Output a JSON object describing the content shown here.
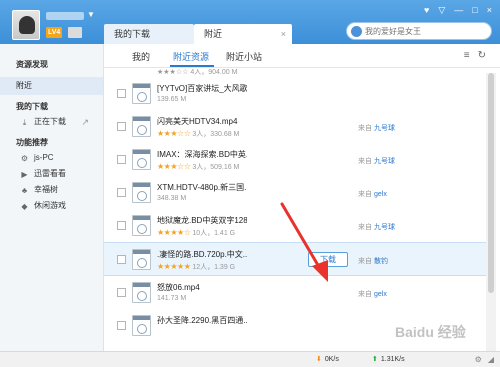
{
  "header": {
    "level_badge": "LV4",
    "tabs": [
      {
        "label": "我的下载"
      },
      {
        "label": "附近"
      }
    ],
    "tab_close": "×",
    "search_placeholder": "我的爱好是女王",
    "window_controls": [
      "♥",
      "▽",
      "—",
      "□",
      "×"
    ]
  },
  "sidebar": {
    "items": [
      {
        "label": "资源发现",
        "type": "heading"
      },
      {
        "label": "附近",
        "type": "selected"
      },
      {
        "label": "我的下载",
        "type": "heading"
      },
      {
        "label": "正在下载",
        "type": "sub",
        "icon": "download-icon"
      },
      {
        "label": "功能推荐",
        "type": "heading"
      },
      {
        "label": "js-PC",
        "type": "sub",
        "icon": "gear-icon"
      },
      {
        "label": "迅雷看看",
        "type": "sub",
        "icon": "play-icon"
      },
      {
        "label": "幸福树",
        "type": "sub",
        "icon": "tree-icon"
      },
      {
        "label": "休闲游戏",
        "type": "sub",
        "icon": "gamepad-icon"
      }
    ]
  },
  "subtabs": [
    {
      "label": "我的"
    },
    {
      "label": "附近资源"
    },
    {
      "label": "附近小站"
    }
  ],
  "list": {
    "top_partial_meta": "4人，904.00 M",
    "rows": [
      {
        "title": "[YYTvO]百家讲坛_大风歌...",
        "stars": "",
        "meta": "139.65 M",
        "source_label": "",
        "source_user": ""
      },
      {
        "title": "闪亮美天HDTV34.mp4",
        "stars": "★★★☆☆",
        "meta": "3人，330.68 M",
        "source_label": "来自",
        "source_user": "九号球"
      },
      {
        "title": "IMAX：深海探索.BD中英...",
        "stars": "★★★☆☆",
        "meta": "3人，509.16 M",
        "source_label": "来自",
        "source_user": "九号球"
      },
      {
        "title": "XTM.HDTV-480p.新三国...",
        "stars": "",
        "meta": "348.38 M",
        "source_label": "来自",
        "source_user": "gelx"
      },
      {
        "title": "地狱魔龙.BD中英双字128...",
        "stars": "★★★★☆",
        "meta": "10人，1.41 G",
        "source_label": "来自",
        "source_user": "九号球"
      },
      {
        "title": ".凄怪的路.BD.720p.中文...",
        "stars": "★★★★★",
        "meta": "12人，1.39 G",
        "source_label": "来自",
        "source_user": "散钓",
        "button": "下载"
      },
      {
        "title": "怒放06.mp4",
        "stars": "",
        "meta": "141.73 M",
        "source_label": "来自",
        "source_user": "gelx"
      },
      {
        "title": "孙大圣降.2290.黑百四通...",
        "stars": "",
        "meta": "",
        "source_label": "",
        "source_user": ""
      }
    ]
  },
  "status": {
    "down_speed": "0K/s",
    "up_speed": "1.31K/s"
  },
  "watermark": "Baidu 经验",
  "colors": {
    "header": "#3c8fd8",
    "accent": "#2b7ad0",
    "star": "#f2a321",
    "arrow": "#e8322b"
  }
}
